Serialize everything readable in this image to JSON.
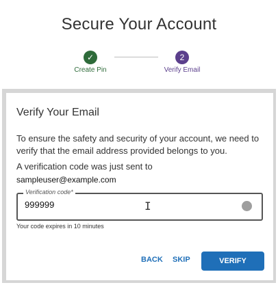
{
  "page": {
    "title": "Secure Your Account"
  },
  "stepper": {
    "steps": [
      {
        "label": "Create Pin",
        "marker": "✓",
        "status": "complete",
        "color": "#2e6b3a"
      },
      {
        "label": "Verify Email",
        "marker": "2",
        "status": "active",
        "color": "#5b3f8c"
      }
    ]
  },
  "card": {
    "title": "Verify Your Email",
    "description": "To ensure the safety and security of your account, we need to verify that the email address provided belongs to you.",
    "sent_text": "A verification code was just sent to",
    "email": "sampleuser@example.com",
    "field": {
      "label": "Verification code*",
      "value": "999999"
    },
    "expiry_text": "Your code expires in 10 minutes",
    "actions": {
      "back_label": "BACK",
      "skip_label": "SKIP",
      "verify_label": "VERIFY"
    }
  },
  "colors": {
    "accent": "#1f6fb8",
    "step_complete": "#2e6b3a",
    "step_active": "#5b3f8c"
  }
}
